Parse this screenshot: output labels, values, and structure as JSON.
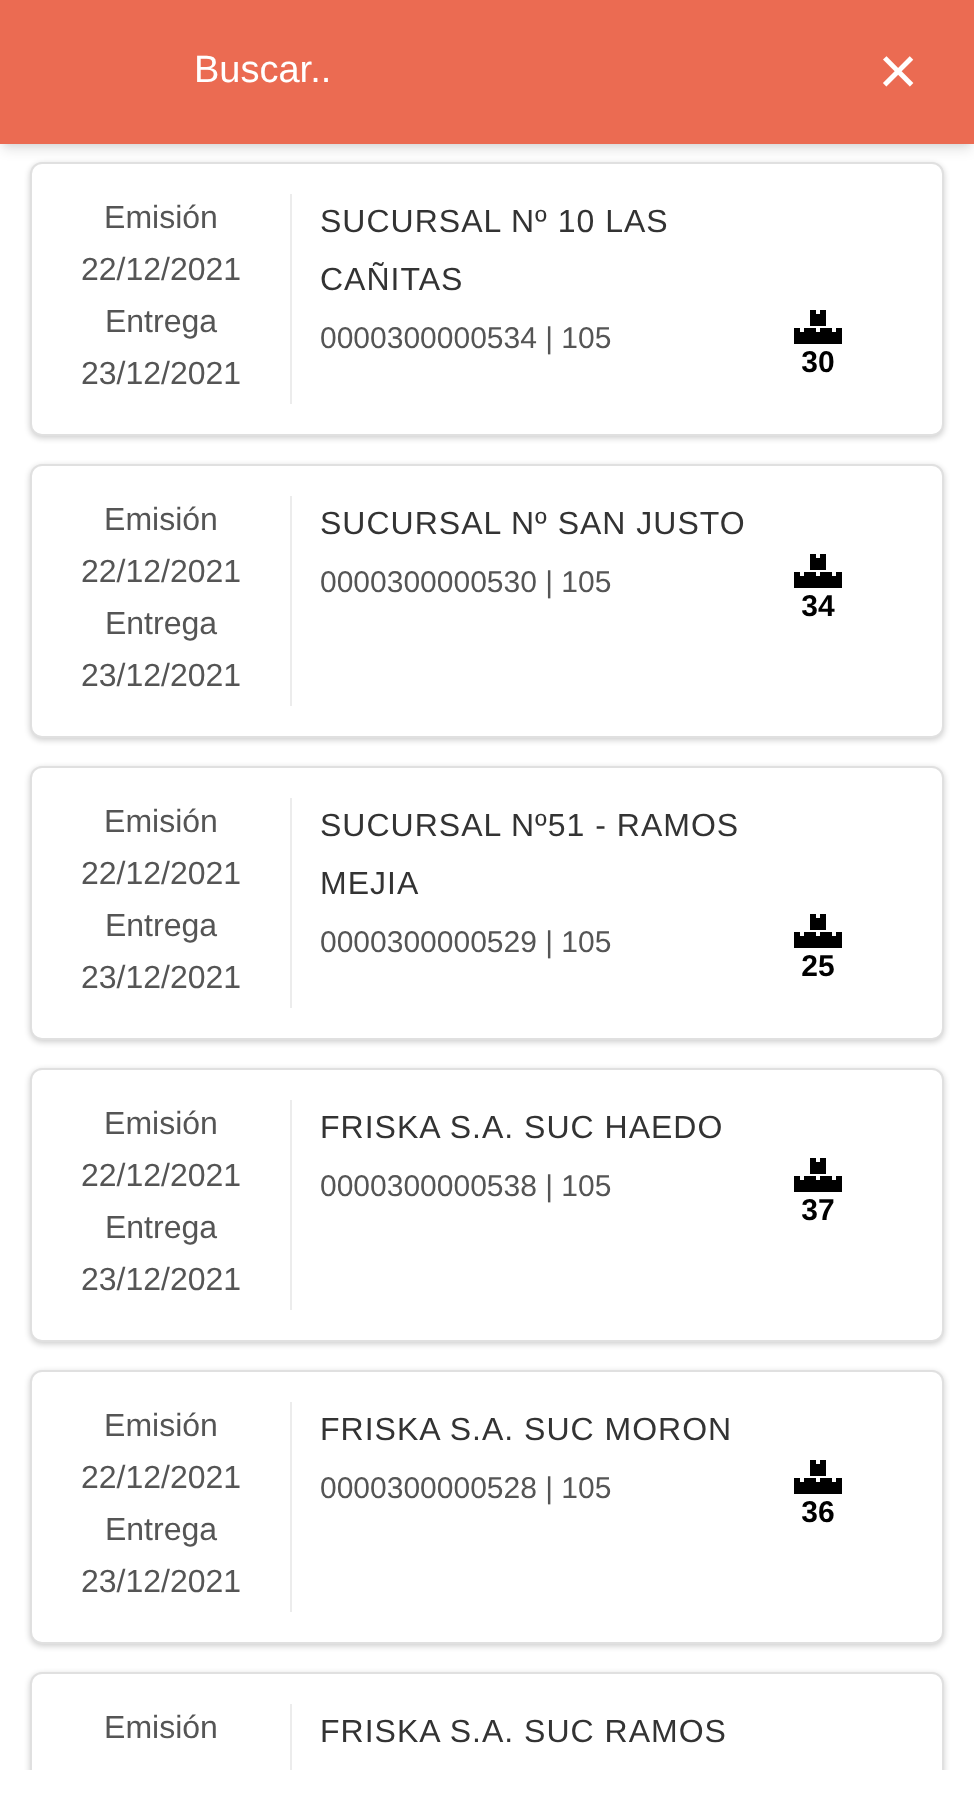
{
  "header": {
    "search_placeholder": "Buscar..",
    "close": "×"
  },
  "orders": [
    {
      "emision_label": "Emisión",
      "emision_date": "22/12/2021",
      "entrega_label": "Entrega",
      "entrega_date": "23/12/2021",
      "name": "SUCURSAL Nº 10 LAS CAÑITAS",
      "code": "0000300000534 | 105",
      "boxes": "30"
    },
    {
      "emision_label": "Emisión",
      "emision_date": "22/12/2021",
      "entrega_label": "Entrega",
      "entrega_date": "23/12/2021",
      "name": "SUCURSAL Nº SAN JUSTO",
      "code": "0000300000530 | 105",
      "boxes": "34"
    },
    {
      "emision_label": "Emisión",
      "emision_date": "22/12/2021",
      "entrega_label": "Entrega",
      "entrega_date": "23/12/2021",
      "name": "SUCURSAL Nº51 - RAMOS MEJIA",
      "code": "0000300000529 | 105",
      "boxes": "25"
    },
    {
      "emision_label": "Emisión",
      "emision_date": "22/12/2021",
      "entrega_label": "Entrega",
      "entrega_date": "23/12/2021",
      "name": "FRISKA S.A. SUC HAEDO",
      "code": "0000300000538 | 105",
      "boxes": "37"
    },
    {
      "emision_label": "Emisión",
      "emision_date": "22/12/2021",
      "entrega_label": "Entrega",
      "entrega_date": "23/12/2021",
      "name": "FRISKA S.A. SUC MORON",
      "code": "0000300000528 | 105",
      "boxes": "36"
    },
    {
      "emision_label": "Emisión",
      "name": "FRISKA S.A. SUC RAMOS"
    }
  ]
}
